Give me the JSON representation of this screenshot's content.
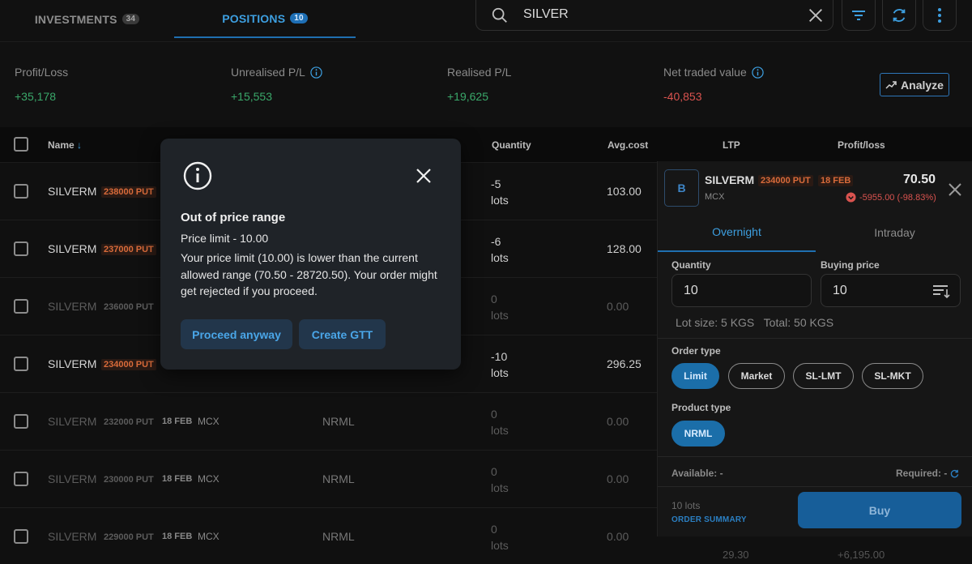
{
  "tabs": {
    "investments": {
      "label": "INVESTMENTS",
      "count": "34"
    },
    "positions": {
      "label": "POSITIONS",
      "count": "10"
    }
  },
  "search": {
    "value": "SILVER"
  },
  "summary": {
    "profit_loss": {
      "label": "Profit/Loss",
      "value": "+35,178"
    },
    "unrealised": {
      "label": "Unrealised P/L",
      "value": "+15,553"
    },
    "realised": {
      "label": "Realised P/L",
      "value": "+19,625"
    },
    "net_traded": {
      "label": "Net traded value",
      "value": "-40,853"
    },
    "analyze_label": "Analyze"
  },
  "table": {
    "headers": {
      "name": "Name",
      "quantity": "Quantity",
      "avg_cost": "Avg.cost",
      "ltp": "LTP",
      "pl": "Profit/loss"
    },
    "rows": [
      {
        "symbol": "SILVERM",
        "strike": "238000 PUT",
        "qty": "-5",
        "unit": "lots",
        "avg": "103.00"
      },
      {
        "symbol": "SILVERM",
        "strike": "237000 PUT",
        "qty": "-6",
        "unit": "lots",
        "avg": "128.00"
      },
      {
        "symbol": "SILVERM",
        "strike": "236000 PUT",
        "qty": "0",
        "unit": "lots",
        "avg": "0.00"
      },
      {
        "symbol": "SILVERM",
        "strike": "234000 PUT",
        "qty": "-10",
        "unit": "lots",
        "avg": "296.25"
      },
      {
        "symbol": "SILVERM",
        "strike": "232000 PUT",
        "expiry": "18 FEB",
        "exchange": "MCX",
        "product": "NRML",
        "qty": "0",
        "unit": "lots",
        "avg": "0.00"
      },
      {
        "symbol": "SILVERM",
        "strike": "230000 PUT",
        "expiry": "18 FEB",
        "exchange": "MCX",
        "product": "NRML",
        "qty": "0",
        "unit": "lots",
        "avg": "0.00"
      },
      {
        "symbol": "SILVERM",
        "strike": "229000 PUT",
        "expiry": "18 FEB",
        "exchange": "MCX",
        "product": "NRML",
        "qty": "0",
        "unit": "lots",
        "avg": "0.00",
        "ltp_partial": "29.30",
        "pl_partial": "+6,195.00"
      }
    ]
  },
  "modal": {
    "title": "Out of price range",
    "limit_line": "Price limit - 10.00",
    "message": "Your price limit (10.00) is lower than the current allowed range (70.50 - 28720.50). Your order might get rejected if you proceed.",
    "proceed_label": "Proceed anyway",
    "gtt_label": "Create GTT"
  },
  "order_panel": {
    "logo_letter": "B",
    "symbol": "SILVERM",
    "strike": "234000 PUT",
    "expiry": "18 FEB",
    "exchange": "MCX",
    "ltp": "70.50",
    "change": "-5955.00 (-98.83%)",
    "tabs": {
      "overnight": "Overnight",
      "intraday": "Intraday"
    },
    "quantity_label": "Quantity",
    "quantity_value": "10",
    "price_label": "Buying price",
    "price_value": "10",
    "lot_info": "Lot size: 5 KGS   Total: 50 KGS",
    "order_type_label": "Order type",
    "order_types": [
      "Limit",
      "Market",
      "SL-LMT",
      "SL-MKT"
    ],
    "product_type_label": "Product type",
    "product_type": "NRML",
    "available": "Available: -",
    "required": "Required: -",
    "lots": "10 lots",
    "order_summary": "ORDER SUMMARY",
    "buy_label": "Buy"
  },
  "colors": {
    "accent": "#1f6fb0",
    "profit": "#3aa86a",
    "loss": "#d9534f",
    "strike": "#d96b3a"
  }
}
